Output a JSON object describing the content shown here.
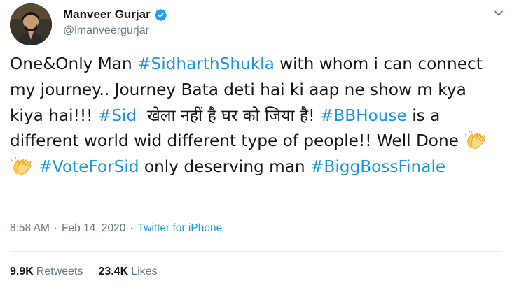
{
  "author": {
    "display_name": "Manveer Gurjar",
    "username": "@imanveergurjar",
    "verified": true
  },
  "icons": {
    "verified": "verified-badge-icon",
    "caret": "chevron-down-icon",
    "emoji": "clapping-hands-emoji"
  },
  "tweet": {
    "segments": [
      {
        "text": "One&Only Man ",
        "type": "text"
      },
      {
        "text": "#SidharthShukla",
        "type": "hashtag"
      },
      {
        "text": " with whom i can connect my journey.. Journey Bata deti hai ki aap ne show m kya kiya hai!!! ",
        "type": "text"
      },
      {
        "text": "#Sid",
        "type": "hashtag"
      },
      {
        "text": "  खेला नहीं है घर को जिया है! ",
        "type": "text"
      },
      {
        "text": "#BBHouse",
        "type": "hashtag"
      },
      {
        "text": " is a different world wid different type of people!! Well Done ",
        "type": "text"
      },
      {
        "text": "👏",
        "type": "emoji"
      },
      {
        "text": "👏",
        "type": "emoji"
      },
      {
        "text": " ",
        "type": "text"
      },
      {
        "text": "#VoteForSid",
        "type": "hashtag"
      },
      {
        "text": " only deserving man ",
        "type": "text"
      },
      {
        "text": "#BiggBossFinale",
        "type": "hashtag"
      }
    ]
  },
  "meta": {
    "time": "8:58 AM",
    "separator": "·",
    "date": "Feb 14, 2020",
    "source": "Twitter for iPhone"
  },
  "stats": {
    "retweets_count": "9.9K",
    "retweets_label": "Retweets",
    "likes_count": "23.4K",
    "likes_label": "Likes"
  },
  "colors": {
    "link": "#1b95e0",
    "muted": "#657786",
    "text": "#14171a",
    "divider": "#e6ecf0"
  }
}
